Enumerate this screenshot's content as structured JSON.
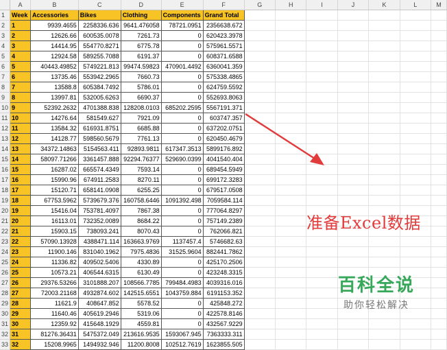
{
  "columns": [
    "A",
    "B",
    "C",
    "D",
    "E",
    "F",
    "G",
    "H",
    "I",
    "J",
    "K",
    "L",
    "M"
  ],
  "header": [
    "Week",
    "Accessories",
    "Bikes",
    "Clothing",
    "Components",
    "Grand Total"
  ],
  "rows": [
    [
      "1",
      "9939.4655",
      "2258336.636",
      "9641.476058",
      "78721.0951",
      "2356638.672"
    ],
    [
      "2",
      "12626.66",
      "600535.0078",
      "7261.73",
      "0",
      "620423.3978"
    ],
    [
      "3",
      "14414.95",
      "554770.8271",
      "6775.78",
      "0",
      "575961.5571"
    ],
    [
      "4",
      "12924.58",
      "589255.7088",
      "6191.37",
      "0",
      "608371.6588"
    ],
    [
      "5",
      "40443.49852",
      "5749221.813",
      "99474.59823",
      "470901.4492",
      "6360041.359"
    ],
    [
      "6",
      "13735.46",
      "553942.2965",
      "7660.73",
      "0",
      "575338.4865"
    ],
    [
      "7",
      "13588.8",
      "605384.7492",
      "5786.01",
      "0",
      "624759.5592"
    ],
    [
      "8",
      "13997.81",
      "532005.6263",
      "6690.37",
      "0",
      "552693.8063"
    ],
    [
      "9",
      "52392.2632",
      "4701388.838",
      "128208.0103",
      "685202.2595",
      "5567191.371"
    ],
    [
      "10",
      "14276.64",
      "581549.627",
      "7921.09",
      "0",
      "603747.357"
    ],
    [
      "11",
      "13584.32",
      "616931.8751",
      "6685.88",
      "0",
      "637202.0751"
    ],
    [
      "12",
      "14128.77",
      "598560.5679",
      "7761.13",
      "0",
      "620450.4679"
    ],
    [
      "13",
      "34372.14863",
      "5154563.411",
      "92893.9811",
      "617347.3513",
      "5899176.892"
    ],
    [
      "14",
      "58097.71266",
      "3361457.888",
      "92294.76377",
      "529690.0399",
      "4041540.404"
    ],
    [
      "15",
      "16287.02",
      "665574.4349",
      "7593.14",
      "0",
      "689454.5949"
    ],
    [
      "16",
      "15990.96",
      "674911.2583",
      "8270.11",
      "0",
      "699172.3283"
    ],
    [
      "17",
      "15120.71",
      "658141.0908",
      "6255.25",
      "0",
      "679517.0508"
    ],
    [
      "18",
      "67753.5962",
      "5739679.376",
      "160758.6446",
      "1091392.498",
      "7059584.114"
    ],
    [
      "19",
      "15416.04",
      "753781.4097",
      "7867.38",
      "0",
      "777064.8297"
    ],
    [
      "20",
      "16113.01",
      "732352.0089",
      "8684.22",
      "0",
      "757149.2389"
    ],
    [
      "21",
      "15903.15",
      "738093.241",
      "8070.43",
      "0",
      "762066.821"
    ],
    [
      "22",
      "57090.13928",
      "4388471.114",
      "163663.9769",
      "1137457.4",
      "5746682.63"
    ],
    [
      "23",
      "11900.146",
      "831040.1962",
      "7975.4836",
      "31525.9604",
      "882441.7862"
    ],
    [
      "24",
      "11336.82",
      "409502.5406",
      "4330.89",
      "0",
      "425170.2506"
    ],
    [
      "25",
      "10573.21",
      "406544.6315",
      "6130.49",
      "0",
      "423248.3315"
    ],
    [
      "26",
      "29376.53266",
      "3101888.207",
      "108566.7785",
      "799484.4983",
      "4039316.016"
    ],
    [
      "27",
      "72003.21168",
      "4932874.602",
      "142515.6551",
      "1043759.884",
      "6191153.352"
    ],
    [
      "28",
      "11621.9",
      "408647.852",
      "5578.52",
      "0",
      "425848.272"
    ],
    [
      "29",
      "11640.46",
      "405619.2946",
      "5319.06",
      "0",
      "422578.8146"
    ],
    [
      "30",
      "12359.92",
      "415648.1929",
      "4559.81",
      "0",
      "432567.9229"
    ],
    [
      "31",
      "81276.36431",
      "5475372.049",
      "213616.9535",
      "1593067.945",
      "7363333.311"
    ],
    [
      "32",
      "15208.9965",
      "1494932.946",
      "11200.8008",
      "102512.7619",
      "1623855.505"
    ]
  ],
  "annotation": "准备Excel数据",
  "logo": {
    "main": "百科全说",
    "sub": "助你轻松解决"
  },
  "colors": {
    "header_fill": "#f7c325",
    "annotation": "#e23b3b",
    "logo": "#37a85a",
    "arrow": "#e23b3b"
  }
}
